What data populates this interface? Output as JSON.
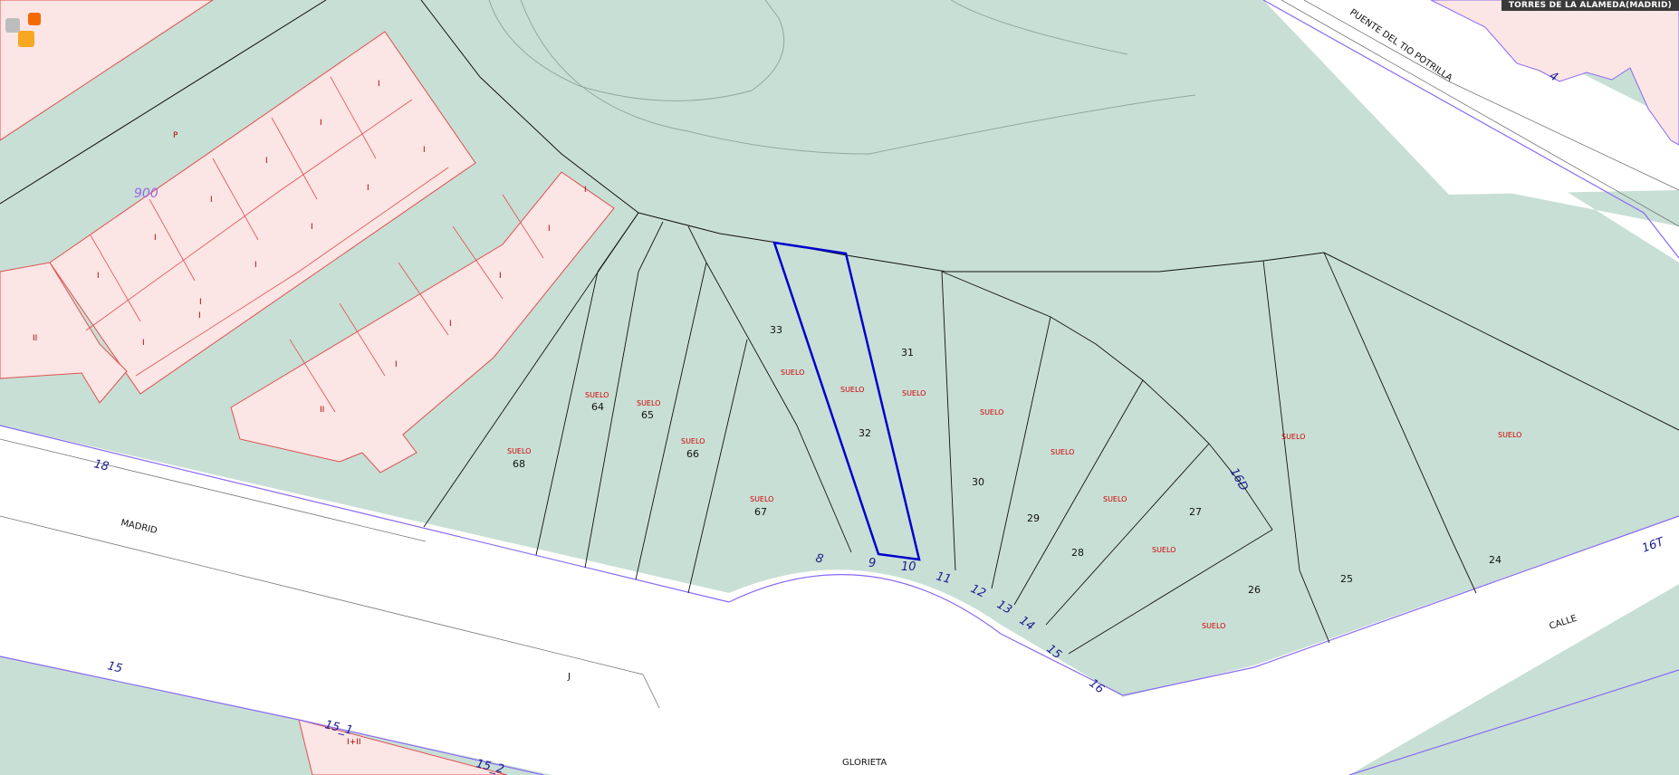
{
  "header": {
    "location_badge": "TORRES DE LA ALAMEDA(MADRID)"
  },
  "logo": {
    "icon": "catastro-logo-icon",
    "colors": [
      "#bdbdbd",
      "#f7a721",
      "#f56a00",
      "#f5c64b"
    ]
  },
  "colors": {
    "parcel_fill": "#c8dfd5",
    "building_fill": "#fbe5e5",
    "building_border": "#e05050",
    "selected_parcel_border": "#0000cc",
    "street_boundary": "#8a6af2",
    "suelo_text": "#d00000"
  },
  "streets": {
    "madrid": "MADRID",
    "glorieta": "GLORIETA",
    "calle": "CALLE",
    "puente_del_tio_potrilla": "PUENTE DEL TIO POTRILLA",
    "letter_j": "J"
  },
  "block_number": "900",
  "building_floors": {
    "p": "P",
    "one": "I",
    "two": "II",
    "one_plus_two": "I+II"
  },
  "parcels": {
    "p68": {
      "label": "SUELO",
      "number": "68"
    },
    "p64": {
      "label": "SUELO",
      "number": "64"
    },
    "p65": {
      "label": "SUELO",
      "number": "65"
    },
    "p66": {
      "label": "SUELO",
      "number": "66"
    },
    "p67": {
      "label": "SUELO",
      "number": "67"
    },
    "p33": {
      "label": "SUELO",
      "number": "33"
    },
    "p32": {
      "label": "SUELO",
      "number": "32"
    },
    "p31": {
      "label": "SUELO",
      "number": "31"
    },
    "p30": {
      "label": "SUELO",
      "number": "30"
    },
    "p29": {
      "label": "SUELO",
      "number": "29"
    },
    "p28": {
      "label": "SUELO",
      "number": "28"
    },
    "p27": {
      "label": "SUELO",
      "number": "27"
    },
    "p26": {
      "label": "SUELO",
      "number": "26"
    },
    "p25": {
      "label": "SUELO",
      "number": "25"
    },
    "p24": {
      "label": "SUELO",
      "number": "24"
    }
  },
  "portal_numbers": {
    "n18": "18",
    "n15a": "15",
    "n8": "8",
    "n9": "9",
    "n10": "10",
    "n11": "11",
    "n12": "12",
    "n13": "13",
    "n14": "14",
    "n15b": "15",
    "n16": "16",
    "n16d": "16D",
    "n16t": "16T",
    "n4": "4",
    "n15_1": "15_1",
    "n15_2": "15_2"
  }
}
